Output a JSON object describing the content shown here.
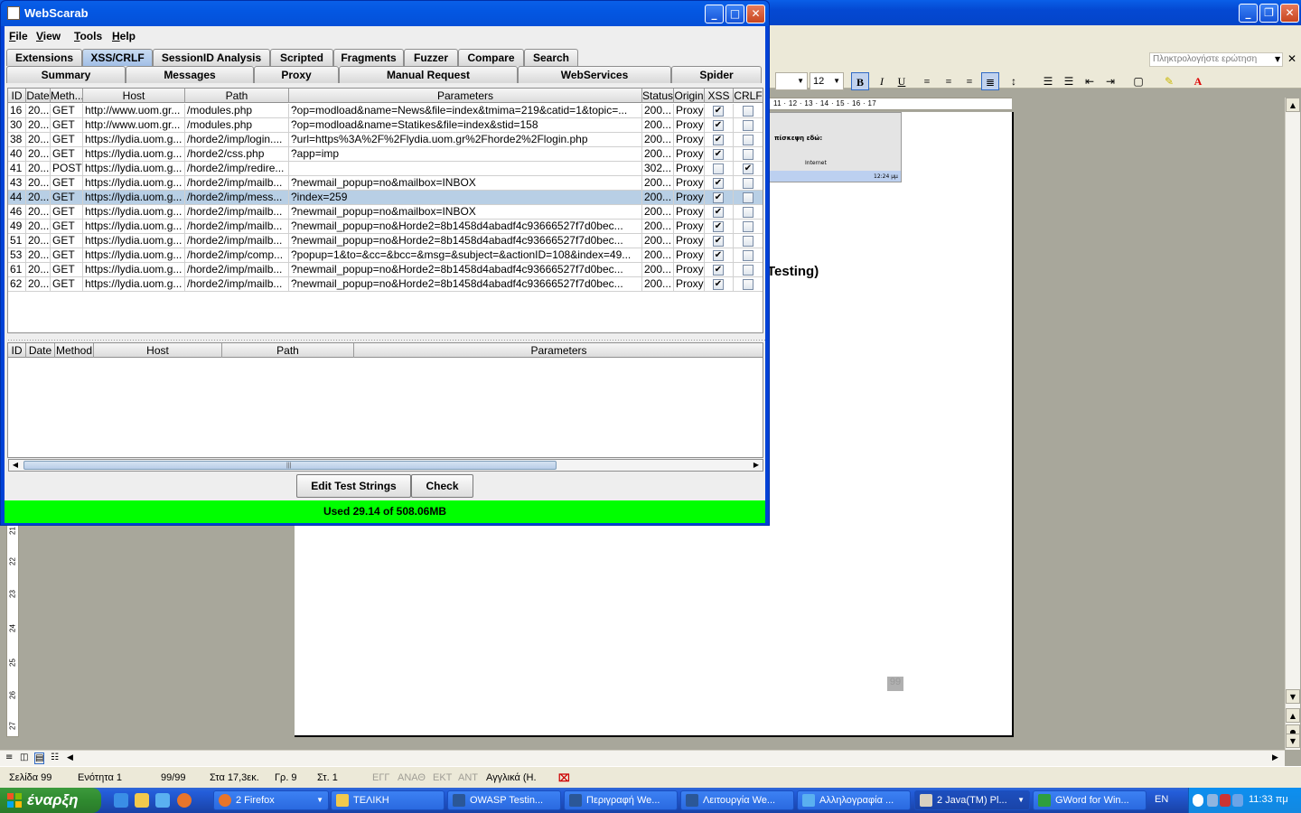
{
  "word": {
    "search_placeholder": "Πληκτρολογήστε ερώτηση",
    "font_size": "12",
    "ruler_ticks": "11 · 12 · 13 · 14 · 15 · 16 · 17",
    "thumbnail_text": "πίσκεψη εδώ:",
    "thumbnail_internet": "Internet",
    "thumbnail_time": "12:24 μμ",
    "text_fragment": "Testing)",
    "page_number": "99",
    "vruler": [
      "27",
      "26",
      "25",
      "24",
      "23",
      "22",
      "21"
    ],
    "status": {
      "page": "Σελίδα 99",
      "section": "Ενότητα 1",
      "count": "99/99",
      "at": "Στα 17,3εκ.",
      "line": "Γρ. 9",
      "col": "Στ. 1",
      "rec": "ΕΓΓ",
      "trk": "ΑΝΑΘ",
      "ext": "ΕΚΤ",
      "ovr": "ΑΝΤ",
      "lang": "Αγγλικά (Η."
    }
  },
  "taskbar": {
    "start": "έναρξη",
    "tasks": [
      "2 Firefox",
      "ΤΕΛΙΚΗ",
      "OWASP Testin...",
      "Περιγραφή We...",
      "Λειτουργία We...",
      "Αλληλογραφία ...",
      "2 Java(TM) Pl...",
      "GWord for Win..."
    ],
    "lang": "EN",
    "time": "11:33 πμ"
  },
  "webscarab": {
    "title": "WebScarab",
    "menu": [
      "File",
      "View",
      "Tools",
      "Help"
    ],
    "tabs_row1": [
      "Extensions",
      "XSS/CRLF",
      "SessionID Analysis",
      "Scripted",
      "Fragments",
      "Fuzzer",
      "Compare",
      "Search"
    ],
    "tabs_row2": [
      "Summary",
      "Messages",
      "Proxy",
      "Manual Request",
      "WebServices",
      "Spider"
    ],
    "top_table": {
      "headers": [
        "ID",
        "Date",
        "Meth...",
        "Host",
        "Path",
        "Parameters",
        "Status",
        "Origin",
        "XSS",
        "CRLF"
      ],
      "rows": [
        [
          "16",
          "20...",
          "GET",
          "http://www.uom.gr...",
          "/modules.php",
          "?op=modload&name=News&file=index&tmima=219&catid=1&topic=...",
          "200...",
          "Proxy",
          true,
          false
        ],
        [
          "30",
          "20...",
          "GET",
          "http://www.uom.gr...",
          "/modules.php",
          "?op=modload&name=Statikes&file=index&stid=158",
          "200...",
          "Proxy",
          true,
          false
        ],
        [
          "38",
          "20...",
          "GET",
          "https://lydia.uom.g...",
          "/horde2/imp/login....",
          "?url=https%3A%2F%2Flydia.uom.gr%2Fhorde2%2Flogin.php",
          "200...",
          "Proxy",
          true,
          false
        ],
        [
          "40",
          "20...",
          "GET",
          "https://lydia.uom.g...",
          "/horde2/css.php",
          "?app=imp",
          "200...",
          "Proxy",
          true,
          false
        ],
        [
          "41",
          "20...",
          "POST",
          "https://lydia.uom.g...",
          "/horde2/imp/redire...",
          "",
          "302...",
          "Proxy",
          false,
          true
        ],
        [
          "43",
          "20...",
          "GET",
          "https://lydia.uom.g...",
          "/horde2/imp/mailb...",
          "?newmail_popup=no&mailbox=INBOX",
          "200...",
          "Proxy",
          true,
          false
        ],
        [
          "44",
          "20...",
          "GET",
          "https://lydia.uom.g...",
          "/horde2/imp/mess...",
          "?index=259",
          "200...",
          "Proxy",
          true,
          false
        ],
        [
          "46",
          "20...",
          "GET",
          "https://lydia.uom.g...",
          "/horde2/imp/mailb...",
          "?newmail_popup=no&mailbox=INBOX",
          "200...",
          "Proxy",
          true,
          false
        ],
        [
          "49",
          "20...",
          "GET",
          "https://lydia.uom.g...",
          "/horde2/imp/mailb...",
          "?newmail_popup=no&Horde2=8b1458d4abadf4c93666527f7d0bec...",
          "200...",
          "Proxy",
          true,
          false
        ],
        [
          "51",
          "20...",
          "GET",
          "https://lydia.uom.g...",
          "/horde2/imp/mailb...",
          "?newmail_popup=no&Horde2=8b1458d4abadf4c93666527f7d0bec...",
          "200...",
          "Proxy",
          true,
          false
        ],
        [
          "53",
          "20...",
          "GET",
          "https://lydia.uom.g...",
          "/horde2/imp/comp...",
          "?popup=1&to=&cc=&bcc=&msg=&subject=&actionID=108&index=49...",
          "200...",
          "Proxy",
          true,
          false
        ],
        [
          "61",
          "20...",
          "GET",
          "https://lydia.uom.g...",
          "/horde2/imp/mailb...",
          "?newmail_popup=no&Horde2=8b1458d4abadf4c93666527f7d0bec...",
          "200...",
          "Proxy",
          true,
          false
        ],
        [
          "62",
          "20...",
          "GET",
          "https://lydia.uom.g...",
          "/horde2/imp/mailb...",
          "?newmail_popup=no&Horde2=8b1458d4abadf4c93666527f7d0bec...",
          "200...",
          "Proxy",
          true,
          false
        ]
      ],
      "selected_row": 6
    },
    "bottom_table": {
      "headers": [
        "ID",
        "Date",
        "Method",
        "Host",
        "Path",
        "Parameters"
      ]
    },
    "buttons": {
      "edit": "Edit Test Strings",
      "check": "Check"
    },
    "memory_status": "Used 29.14 of 508.06MB",
    "check_mark": "✔"
  },
  "colors": {
    "status_green": "#00ff00",
    "xp_blue": "#0450d8",
    "selected_row": "#b8cfe5"
  }
}
